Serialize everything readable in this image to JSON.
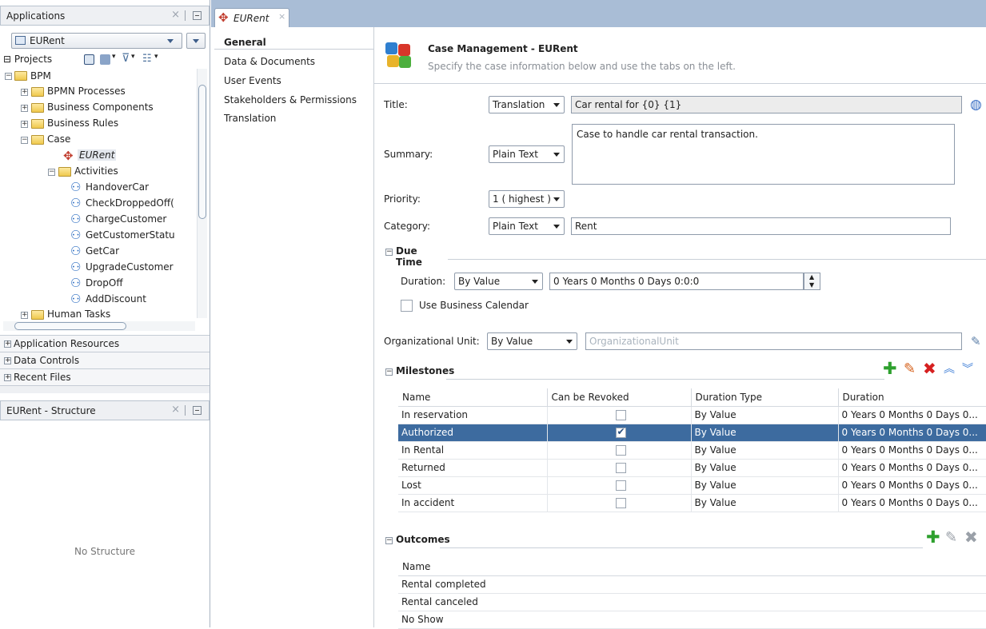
{
  "applications_panel": {
    "title": "Applications",
    "app_selected": "EURent",
    "projects_label": "Projects"
  },
  "tree": {
    "root": "BPM",
    "items": [
      {
        "label": "BPMN Processes"
      },
      {
        "label": "Business Components"
      },
      {
        "label": "Business Rules"
      },
      {
        "label": "Case"
      },
      {
        "label": "EURent"
      },
      {
        "label": "Activities"
      },
      {
        "label": "HandoverCar"
      },
      {
        "label": "CheckDroppedOff("
      },
      {
        "label": "ChargeCustomer"
      },
      {
        "label": "GetCustomerStatu"
      },
      {
        "label": "GetCar"
      },
      {
        "label": "UpgradeCustomer"
      },
      {
        "label": "DropOff"
      },
      {
        "label": "AddDiscount"
      },
      {
        "label": "Human Tasks"
      }
    ]
  },
  "accordions": [
    "Application Resources",
    "Data Controls",
    "Recent Files"
  ],
  "structure_panel": {
    "title": "EURent - Structure",
    "empty_text": "No Structure"
  },
  "editor_tab": {
    "label": "EURent"
  },
  "nav": {
    "items": [
      "General",
      "Data & Documents",
      "User Events",
      "Stakeholders & Permissions",
      "Translation"
    ]
  },
  "header": {
    "title": "Case Management - EURent",
    "subtitle": "Specify the case information below and use the tabs on the left."
  },
  "form": {
    "title_label": "Title:",
    "title_mode": "Translation",
    "title_value": "Car rental for {0} {1}",
    "summary_label": "Summary:",
    "summary_mode": "Plain Text",
    "summary_value": "Case to handle car rental transaction.",
    "priority_label": "Priority:",
    "priority_value": "1 ( highest )",
    "category_label": "Category:",
    "category_mode": "Plain Text",
    "category_value": "Rent"
  },
  "due_time": {
    "section": "Due Time",
    "duration_label": "Duration:",
    "duration_mode": "By Value",
    "duration_value": "0 Years 0 Months 0 Days 0:0:0",
    "business_calendar_label": "Use Business Calendar",
    "org_unit_label": "Organizational Unit:",
    "org_unit_mode": "By Value",
    "org_unit_placeholder": "OrganizationalUnit"
  },
  "milestones": {
    "section": "Milestones",
    "columns": [
      "Name",
      "Can be Revoked",
      "Duration Type",
      "Duration"
    ],
    "rows": [
      {
        "name": "In reservation",
        "revoked": false,
        "type": "By Value",
        "duration": "0 Years 0 Months 0 Days 0..."
      },
      {
        "name": "Authorized",
        "revoked": true,
        "type": "By Value",
        "duration": "0 Years 0 Months 0 Days 0..."
      },
      {
        "name": "In Rental",
        "revoked": false,
        "type": "By Value",
        "duration": "0 Years 0 Months 0 Days 0..."
      },
      {
        "name": "Returned",
        "revoked": false,
        "type": "By Value",
        "duration": "0 Years 0 Months 0 Days 0..."
      },
      {
        "name": "Lost",
        "revoked": false,
        "type": "By Value",
        "duration": "0 Years 0 Months 0 Days 0..."
      },
      {
        "name": "In accident",
        "revoked": false,
        "type": "By Value",
        "duration": "0 Years 0 Months 0 Days 0..."
      }
    ],
    "selected_row": 1
  },
  "outcomes": {
    "section": "Outcomes",
    "column": "Name",
    "rows": [
      "Rental completed",
      "Rental canceled",
      "No Show"
    ]
  },
  "colors": {
    "selection": "#3d6b9f",
    "tabstrip": "#a9bdd6",
    "add_green": "#2ea02e",
    "delete_red": "#d62020"
  }
}
